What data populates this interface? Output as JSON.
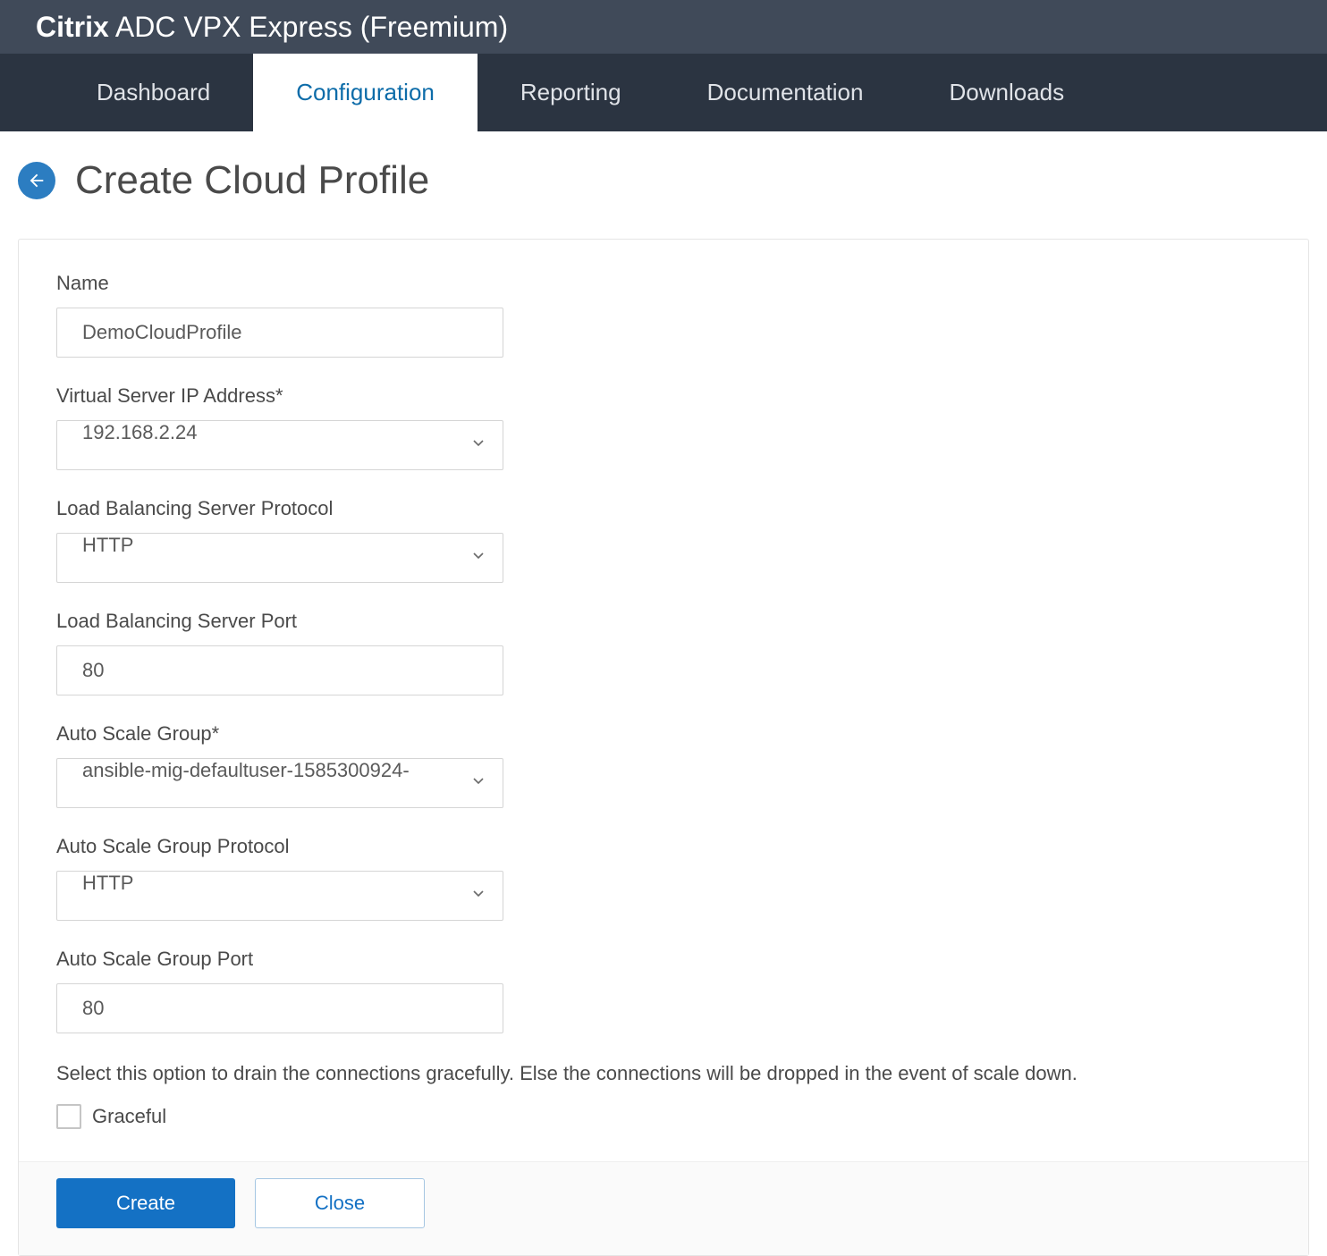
{
  "header": {
    "brand_bold": "Citrix",
    "brand_rest": " ADC VPX Express (Freemium)"
  },
  "nav": {
    "tabs": [
      {
        "label": "Dashboard",
        "active": false
      },
      {
        "label": "Configuration",
        "active": true
      },
      {
        "label": "Reporting",
        "active": false
      },
      {
        "label": "Documentation",
        "active": false
      },
      {
        "label": "Downloads",
        "active": false
      }
    ]
  },
  "page": {
    "title": "Create Cloud Profile"
  },
  "form": {
    "name": {
      "label": "Name",
      "value": "DemoCloudProfile"
    },
    "vserver_ip": {
      "label": "Virtual Server IP Address*",
      "value": "192.168.2.24"
    },
    "lb_protocol": {
      "label": "Load Balancing Server Protocol",
      "value": "HTTP"
    },
    "lb_port": {
      "label": "Load Balancing Server Port",
      "value": "80"
    },
    "asg": {
      "label": "Auto Scale Group*",
      "value": "ansible-mig-defaultuser-1585300924-"
    },
    "asg_protocol": {
      "label": "Auto Scale Group Protocol",
      "value": "HTTP"
    },
    "asg_port": {
      "label": "Auto Scale Group Port",
      "value": "80"
    },
    "graceful": {
      "hint": "Select this option to drain the connections gracefully. Else the connections will be dropped in the event of scale down.",
      "label": "Graceful",
      "checked": false
    }
  },
  "buttons": {
    "create": "Create",
    "close": "Close"
  }
}
